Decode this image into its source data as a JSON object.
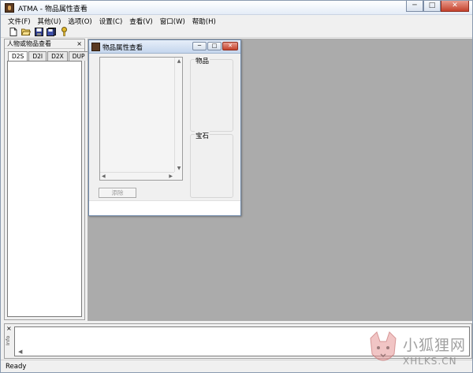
{
  "window": {
    "title": "ATMA - 物品属性查看",
    "minimize": "─",
    "maximize": "□",
    "close": "✕"
  },
  "menu": [
    {
      "label": "文件(F)"
    },
    {
      "label": "其他(U)"
    },
    {
      "label": "选项(O)"
    },
    {
      "label": "设置(C)"
    },
    {
      "label": "查看(V)"
    },
    {
      "label": "窗口(W)"
    },
    {
      "label": "帮助(H)"
    }
  ],
  "toolbar": {
    "icons": [
      "new-icon",
      "open-icon",
      "save-icon",
      "save-all-icon",
      "key-icon"
    ]
  },
  "dock": {
    "title": "人物或物品查看",
    "close": "×",
    "tabs": [
      "D2S",
      "D2I",
      "D2X",
      "DUP"
    ],
    "active_tab": "D2S"
  },
  "child_window": {
    "title": "物品属性查看",
    "items_group": "物品",
    "gems_group": "宝石",
    "delete_button": "添除"
  },
  "info_panel": {
    "close": "×",
    "label": "Info"
  },
  "status": {
    "text": "Ready"
  },
  "watermark": {
    "line1": "小狐狸网",
    "line2": "XHLKS.CN"
  },
  "colors": {
    "mdi_background": "#ababab",
    "panel_background": "#f0f0f0",
    "close_button": "#c4422c"
  }
}
